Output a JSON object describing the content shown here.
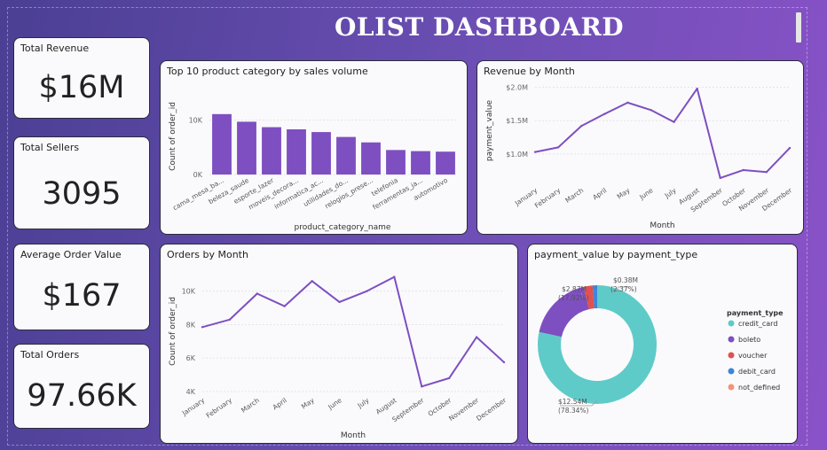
{
  "dashboard": {
    "title": "OLIST DASHBOARD"
  },
  "kpis": [
    {
      "label": "Total Revenue",
      "value": "$16M"
    },
    {
      "label": "Total Sellers",
      "value": "3095"
    },
    {
      "label": "Average Order Value",
      "value": "$167"
    },
    {
      "label": "Total Orders",
      "value": "97.66K"
    }
  ],
  "colors": {
    "accent": "#7e4fc1",
    "line": "#7e4fc1",
    "credit_card": "#5ecbc8",
    "boleto": "#7e4fc1",
    "voucher": "#e0514f",
    "debit_card": "#3d86d8",
    "not_defined": "#f2947c"
  },
  "chart_data": [
    {
      "type": "bar",
      "title": "Top 10 product category by sales volume",
      "xlabel": "product_category_name",
      "ylabel": "Count of order_id",
      "categories": [
        "cama_mesa_ba...",
        "beleza_saude",
        "esporte_lazer",
        "moveis_decora...",
        "informatica_ac...",
        "utilidades_do...",
        "relogios_prese...",
        "telefonia",
        "ferramentas_ja...",
        "automotivo"
      ],
      "values": [
        11100,
        9700,
        8700,
        8300,
        7800,
        6900,
        5900,
        4500,
        4300,
        4200
      ],
      "ylim": [
        0,
        14000
      ],
      "yticks": [
        {
          "v": 0,
          "label": "0K"
        },
        {
          "v": 10000,
          "label": "10K"
        }
      ]
    },
    {
      "type": "line",
      "title": "Revenue by Month",
      "xlabel": "Month",
      "ylabel": "payment_value",
      "categories": [
        "January",
        "February",
        "March",
        "April",
        "May",
        "June",
        "July",
        "August",
        "September",
        "October",
        "November",
        "December"
      ],
      "values": [
        1030000,
        1100000,
        1420000,
        1600000,
        1770000,
        1660000,
        1480000,
        1980000,
        640000,
        760000,
        730000,
        1090000
      ],
      "ylim": [
        600000,
        2100000
      ],
      "yticks": [
        {
          "v": 1000000,
          "label": "$1.0M"
        },
        {
          "v": 1500000,
          "label": "$1.5M"
        },
        {
          "v": 2000000,
          "label": "$2.0M"
        }
      ]
    },
    {
      "type": "line",
      "title": "Orders by Month",
      "xlabel": "Month",
      "ylabel": "Count of order_id",
      "categories": [
        "January",
        "February",
        "March",
        "April",
        "May",
        "June",
        "July",
        "August",
        "September",
        "October",
        "November",
        "December"
      ],
      "values": [
        7850,
        8300,
        9850,
        9100,
        10600,
        9350,
        10000,
        10850,
        4300,
        4800,
        7250,
        5750
      ],
      "ylim": [
        4000,
        11200
      ],
      "yticks": [
        {
          "v": 4000,
          "label": "4K"
        },
        {
          "v": 6000,
          "label": "6K"
        },
        {
          "v": 8000,
          "label": "8K"
        },
        {
          "v": 10000,
          "label": "10K"
        }
      ]
    },
    {
      "type": "pie",
      "title": "payment_value by payment_type",
      "legend_title": "payment_type",
      "legend": [
        "credit_card",
        "boleto",
        "voucher",
        "debit_card",
        "not_defined"
      ],
      "values": [
        78.34,
        17.92,
        2.37,
        1.37,
        0.0
      ],
      "labels": [
        {
          "value": "$12.54M",
          "pct": "(78.34%)"
        },
        {
          "value": "$2.87M",
          "pct": "(17.92%)"
        },
        {
          "value": "$0.38M",
          "pct": "(2.37%)"
        }
      ]
    }
  ]
}
